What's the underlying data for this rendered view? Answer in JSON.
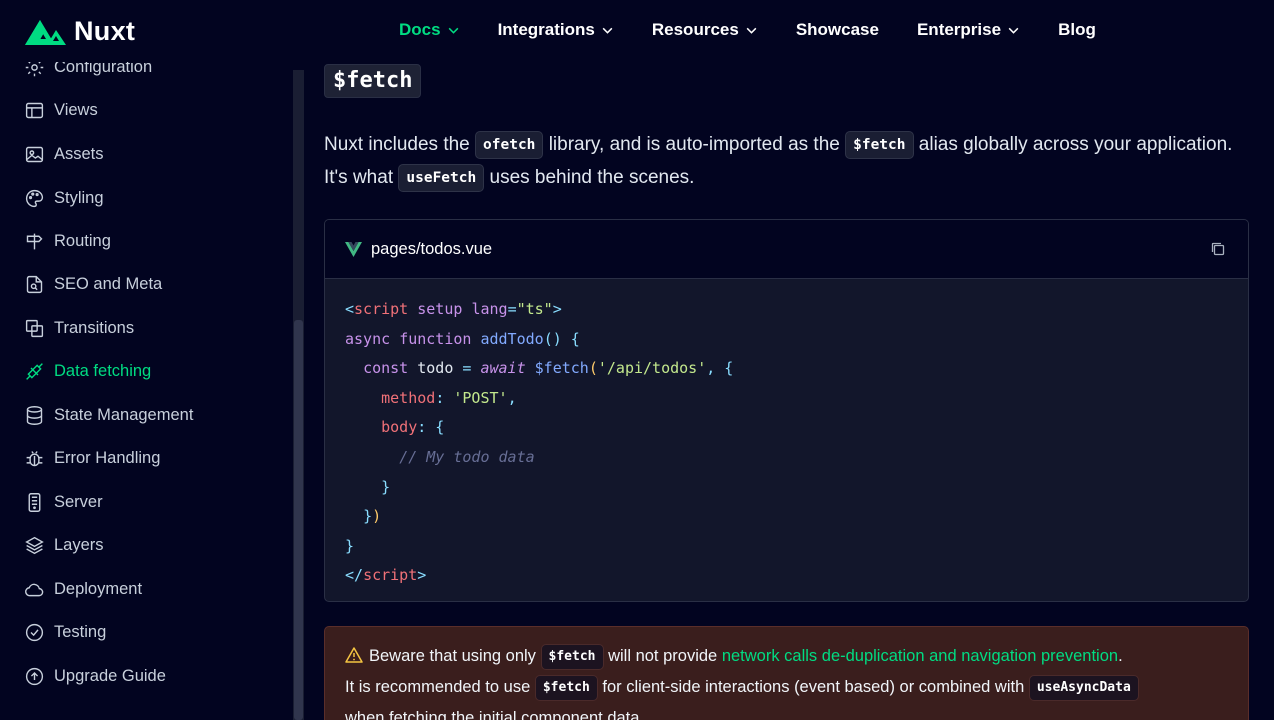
{
  "brand": {
    "name": "Nuxt",
    "accent": "#00dc82"
  },
  "nav": [
    {
      "label": "Docs",
      "active": true,
      "dropdown": true
    },
    {
      "label": "Integrations",
      "dropdown": true
    },
    {
      "label": "Resources",
      "dropdown": true
    },
    {
      "label": "Showcase",
      "dropdown": false
    },
    {
      "label": "Enterprise",
      "dropdown": true
    },
    {
      "label": "Blog",
      "dropdown": false
    }
  ],
  "sidebar": {
    "items": [
      {
        "label": "Configuration",
        "icon": "gear-icon"
      },
      {
        "label": "Views",
        "icon": "layout-icon"
      },
      {
        "label": "Assets",
        "icon": "image-icon"
      },
      {
        "label": "Styling",
        "icon": "palette-icon"
      },
      {
        "label": "Routing",
        "icon": "signpost-icon"
      },
      {
        "label": "SEO and Meta",
        "icon": "file-search-icon"
      },
      {
        "label": "Transitions",
        "icon": "transition-icon"
      },
      {
        "label": "Data fetching",
        "icon": "plug-icon",
        "active": true
      },
      {
        "label": "State Management",
        "icon": "database-icon"
      },
      {
        "label": "Error Handling",
        "icon": "bug-icon"
      },
      {
        "label": "Server",
        "icon": "server-icon"
      },
      {
        "label": "Layers",
        "icon": "layers-icon"
      },
      {
        "label": "Deployment",
        "icon": "cloud-icon"
      },
      {
        "label": "Testing",
        "icon": "check-circle-icon"
      },
      {
        "label": "Upgrade Guide",
        "icon": "arrow-up-circle-icon"
      }
    ]
  },
  "content": {
    "heading": "$fetch",
    "para": {
      "t1": "Nuxt includes the ",
      "c1": "ofetch",
      "t2": " library, and is auto-imported as the ",
      "c2": "$fetch",
      "t3": " alias globally across your application. It's what ",
      "c3": "useFetch",
      "t4": " uses behind the scenes."
    },
    "code": {
      "filename": "pages/todos.vue",
      "tok": {
        "script": "script",
        "setup": "setup",
        "lang": "lang",
        "ts": "\"ts\"",
        "async": "async",
        "function": "function",
        "addTodo": "addTodo",
        "const": "const",
        "todo": "todo",
        "await": "await",
        "fetch": "$fetch",
        "url": "'/api/todos'",
        "method": "method",
        "post": "'POST'",
        "body": "body",
        "comment": "// My todo data"
      }
    },
    "warning": {
      "t1": "Beware that using only ",
      "c1": "$fetch",
      "t2": " will not provide ",
      "link": "network calls de-duplication and navigation prevention",
      "t3": ".",
      "t4": "It is recommended to use ",
      "c2": "$fetch",
      "t5": " for client-side interactions (event based) or combined with ",
      "c3": "useAsyncData",
      "t6": "when fetching the initial component data."
    }
  }
}
